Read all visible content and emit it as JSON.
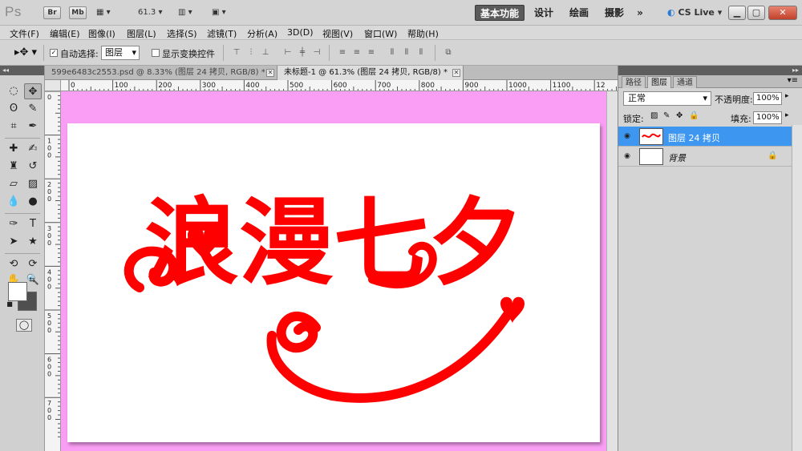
{
  "titlebar": {
    "logo": "Ps",
    "bridge": "Br",
    "minibridge": "Mb",
    "zoom": "61.3",
    "workspaces": [
      "基本功能",
      "设计",
      "绘画",
      "摄影"
    ],
    "more": "»",
    "cs_live": "CS Live"
  },
  "menu": [
    "文件(F)",
    "编辑(E)",
    "图像(I)",
    "图层(L)",
    "选择(S)",
    "滤镜(T)",
    "分析(A)",
    "3D(D)",
    "视图(V)",
    "窗口(W)",
    "帮助(H)"
  ],
  "options": {
    "auto_select_label": "自动选择:",
    "auto_select_checked": true,
    "auto_select_value": "图层",
    "show_transform_label": "显示变换控件",
    "show_transform_checked": false
  },
  "doc_tabs": [
    {
      "label": "599e6483c2553.psd @ 8.33% (图层 24 拷贝, RGB/8) *",
      "active": false
    },
    {
      "label": "未标题-1 @ 61.3% (图层 24 拷贝, RGB/8) *",
      "active": true
    }
  ],
  "ruler_h_labels": [
    "0",
    "100",
    "200",
    "300",
    "400",
    "500",
    "600",
    "700",
    "800",
    "900",
    "1000",
    "1100",
    "12"
  ],
  "ruler_v_labels": [
    "0",
    "1 0 0",
    "2 0 0",
    "3 0 0",
    "4 0 0",
    "5 0 0",
    "6 0 0",
    "7 0 0"
  ],
  "canvas": {
    "background_color": "#f99ef4",
    "artwork_text": "浪漫七夕",
    "artwork_color": "#ff0000"
  },
  "panel": {
    "tabs": [
      "路径",
      "图层",
      "通道"
    ],
    "active_tab": "图层",
    "blend_mode": "正常",
    "opacity_label": "不透明度:",
    "opacity_value": "100%",
    "lock_label": "锁定:",
    "fill_label": "填充:",
    "fill_value": "100%",
    "layers": [
      {
        "name": "图层 24 拷贝",
        "selected": true,
        "visible": true,
        "locked": false
      },
      {
        "name": "背景",
        "selected": false,
        "visible": true,
        "locked": true
      }
    ]
  },
  "colors": {
    "accent_selected": "#3d96f0",
    "foreground": "#ffffff",
    "background": "#4f4f4f"
  }
}
